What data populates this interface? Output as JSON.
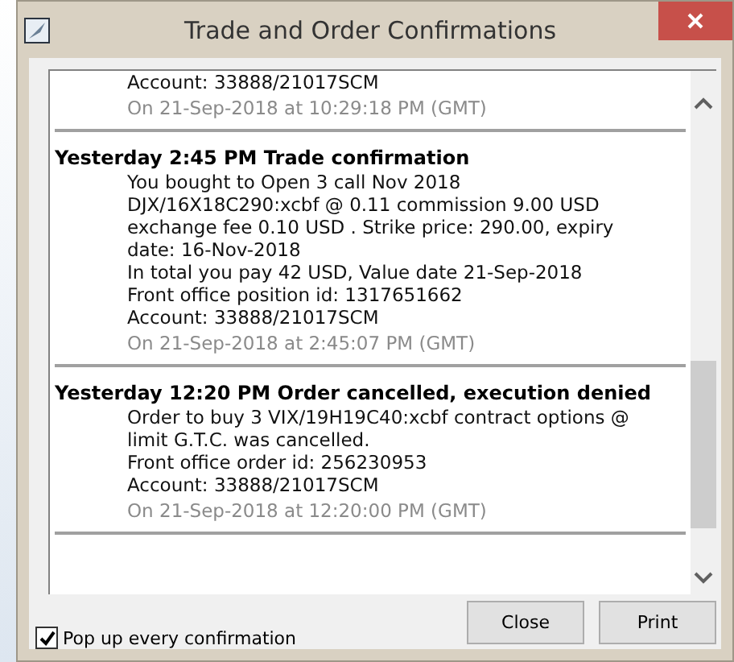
{
  "window": {
    "title": "Trade and Order Confirmations"
  },
  "entries": [
    {
      "lines": [
        "Account: 33888/21017SCM"
      ],
      "timestamp": "On 21-Sep-2018 at 10:29:18 PM (GMT)"
    },
    {
      "heading": "Yesterday 2:45 PM Trade confirmation",
      "lines": [
        "You bought to Open 3 call Nov 2018",
        "DJX/16X18C290:xcbf @ 0.11 commission 9.00 USD",
        "exchange fee 0.10 USD . Strike price: 290.00, expiry",
        "date: 16-Nov-2018",
        "In total you pay 42 USD, Value date 21-Sep-2018",
        "Front office position id: 1317651662",
        "Account: 33888/21017SCM"
      ],
      "timestamp": "On 21-Sep-2018 at 2:45:07 PM (GMT)"
    },
    {
      "heading": "Yesterday 12:20 PM Order cancelled, execution denied",
      "lines": [
        "Order to buy 3 VIX/19H19C40:xcbf contract options @",
        "limit G.T.C. was cancelled.",
        "Front office order id: 256230953",
        "Account: 33888/21017SCM"
      ],
      "timestamp": "On 21-Sep-2018 at 12:20:00 PM (GMT)"
    }
  ],
  "popup_option": {
    "label": "Pop up every confirmation",
    "checked": true
  },
  "buttons": [
    "Close",
    "Print"
  ]
}
